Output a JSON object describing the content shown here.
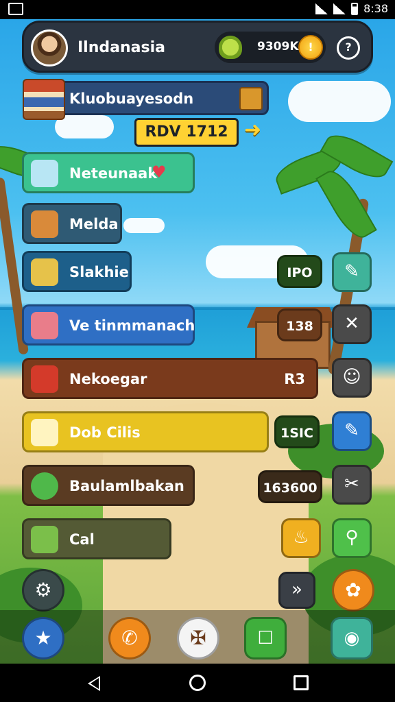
{
  "status_bar": {
    "time": "8:38"
  },
  "header": {
    "username": "Ilndanasia",
    "coins": "9309K",
    "coin_symbol": "!",
    "help_symbol": "?"
  },
  "banner": {
    "title": "Kluobuayesodn",
    "code": "RDV 1712"
  },
  "menu": [
    {
      "label": "Neteunaak",
      "color": "#3bc28f"
    },
    {
      "label": "Melda",
      "color": "#2f5a74"
    },
    {
      "label": "Slakhie",
      "color": "#1d5f8a"
    },
    {
      "label": "Ve tinmmanach",
      "color": "#2f6fc4"
    },
    {
      "label": "Nekoegar",
      "color": "#7a3a1c"
    },
    {
      "label": "Dob Cilis",
      "color": "#e8c321"
    },
    {
      "label": "Baulamlbakan",
      "color": "#5a3b22"
    },
    {
      "label": "Cal",
      "color": "#545a35"
    }
  ],
  "right_values": {
    "v1": "IPO",
    "v2": "138",
    "v3": "R3",
    "v4": "1SIC",
    "v5": "163600"
  },
  "accent": {
    "green": "#3f9f2c",
    "yellow": "#ffd233",
    "blue": "#2f6fc4",
    "orange": "#f08a1c"
  }
}
